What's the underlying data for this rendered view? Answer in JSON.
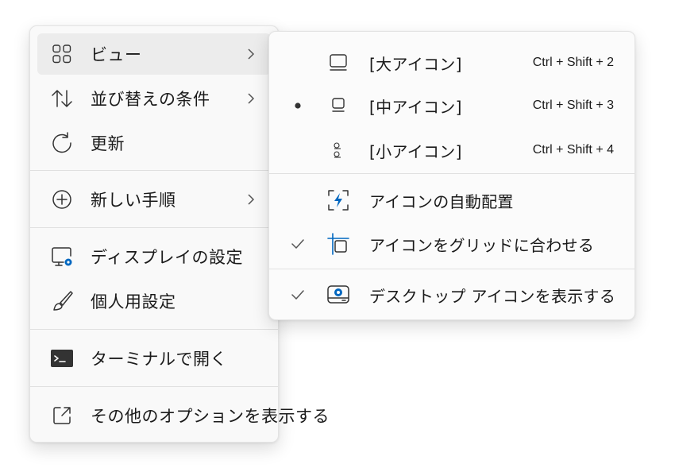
{
  "main_menu": {
    "items": [
      {
        "label": "ビュー",
        "icon": "grid-icon"
      },
      {
        "label": "並び替えの条件",
        "icon": "sort-arrows-icon"
      },
      {
        "label": "更新",
        "icon": "refresh-icon"
      },
      {
        "label": "新しい手順",
        "icon": "add-circle-icon"
      },
      {
        "label": "ディスプレイの設定",
        "icon": "display-settings-icon"
      },
      {
        "label": "個人用設定",
        "icon": "paintbrush-icon"
      },
      {
        "label": "ターミナルで開く",
        "icon": "terminal-icon"
      },
      {
        "label": "その他のオプションを表示する",
        "icon": "open-external-icon"
      }
    ]
  },
  "view_submenu": {
    "items": [
      {
        "label": "[大アイコン]",
        "shortcut": "Ctrl + Shift + 2",
        "icon": "large-icon-view-icon",
        "selected": false
      },
      {
        "label": "[中アイコン]",
        "shortcut": "Ctrl + Shift + 3",
        "icon": "medium-icon-view-icon",
        "selected": true
      },
      {
        "label": "[小アイコン]",
        "shortcut": "Ctrl + Shift + 4",
        "icon": "small-icon-view-icon",
        "selected": false
      },
      {
        "label": "アイコンの自動配置",
        "icon": "auto-arrange-icon",
        "checked": false
      },
      {
        "label": "アイコンをグリッドに合わせる",
        "icon": "align-grid-icon",
        "checked": true
      },
      {
        "label": "デスクトップ アイコンを表示する",
        "icon": "show-desktop-icons-icon",
        "checked": true
      }
    ]
  },
  "colors": {
    "accent": "#0067c0",
    "hover": "#ececec",
    "menu_bg": "#f9f9f9"
  }
}
